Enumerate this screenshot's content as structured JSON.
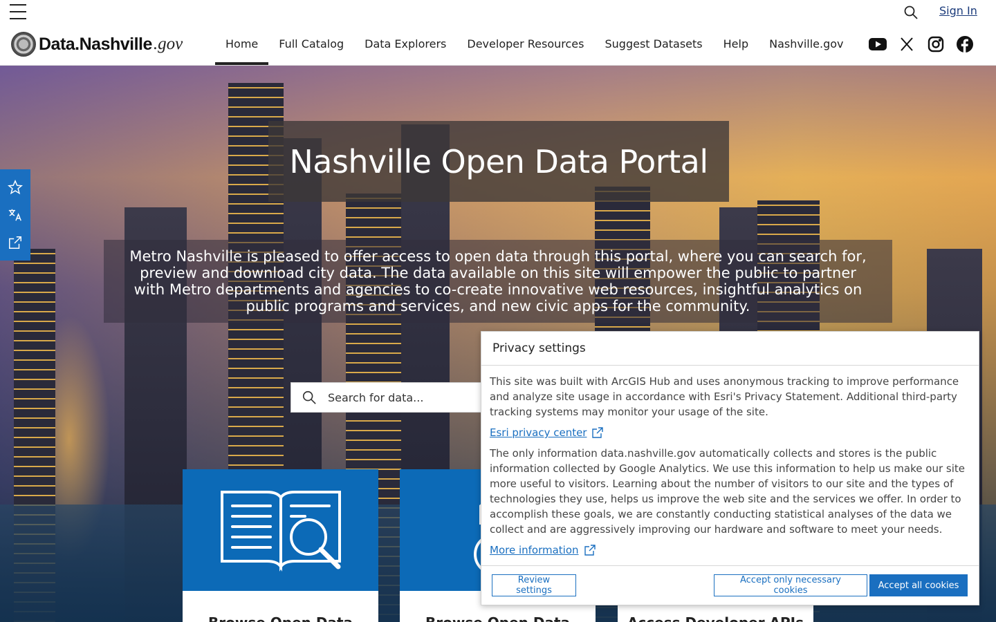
{
  "topbar": {
    "menu_icon": "hamburger-menu-icon",
    "search_icon": "search-icon",
    "signin_label": "Sign In"
  },
  "logo": {
    "name_label": "Data.Nashville",
    "suffix_label": ".gov"
  },
  "nav": {
    "items": [
      {
        "label": "Home",
        "active": true
      },
      {
        "label": "Full Catalog"
      },
      {
        "label": "Data Explorers"
      },
      {
        "label": "Developer Resources"
      },
      {
        "label": "Suggest Datasets"
      },
      {
        "label": "Help"
      },
      {
        "label": "Nashville.gov"
      }
    ]
  },
  "social": {
    "icons": [
      "youtube-icon",
      "x-icon",
      "instagram-icon",
      "facebook-icon"
    ]
  },
  "hero": {
    "title": "Nashville Open Data Portal",
    "description": "Metro Nashville is pleased to offer access to open data through this portal, where you can search for, preview and download city data. The data available on this site will empower the public to partner with Metro departments and agencies to co-create innovative web resources, insightful analytics on public programs and services, and new civic apps for the community.",
    "search_placeholder": "Search for data..."
  },
  "side_tools": {
    "icons": [
      "star-icon",
      "translate-icon",
      "share-icon"
    ]
  },
  "cards": [
    {
      "label": "Browse Open Data",
      "icon": "book-search-icon"
    },
    {
      "label": "Browse Open Data",
      "icon": "map-chart-icon"
    },
    {
      "label": "Access Developer APIs",
      "icon": "code-icon"
    }
  ],
  "privacy": {
    "title": "Privacy settings",
    "para1": "This site was built with ArcGIS Hub and uses anonymous tracking to improve performance and analyze site usage in accordance with Esri's Privacy Statement. Additional third-party tracking systems may monitor your usage of the site.",
    "link1": "Esri privacy center",
    "para2": "The only information data.nashville.gov automatically collects and stores is the public information collected by Google Analytics. We use this information to help us make our site more useful to visitors. Learning about the number of visitors to our site and the types of technologies they use, helps us improve the web site and the services we offer. In order to accomplish these goals, we are constantly conducting statistical analyses of the data we collect and are aggressively improving our hardware and software to meet your needs.",
    "link2": "More information",
    "btn_review": "Review settings",
    "btn_necessary": "Accept only necessary cookies",
    "btn_all": "Accept all cookies"
  },
  "colors": {
    "accent": "#1a6fc0",
    "card_blue": "#0c6ab7",
    "link_dark": "#1a3a7a"
  }
}
